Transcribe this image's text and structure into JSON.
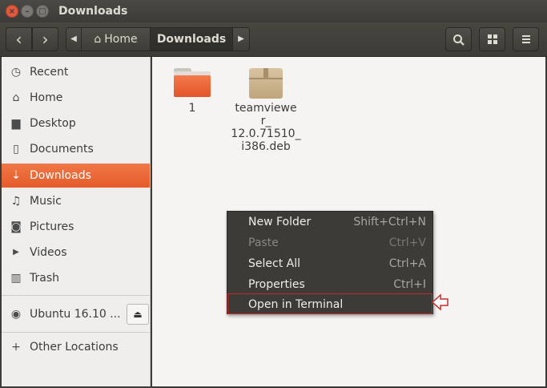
{
  "window": {
    "title": "Downloads",
    "controls": {
      "close": "×",
      "minimize": "–",
      "maximize": "□"
    }
  },
  "header": {
    "back_icon": "‹",
    "forward_icon": "›",
    "breadcrumb_left": "◀",
    "breadcrumb_right": "▶",
    "home_label": "Home",
    "current_label": "Downloads",
    "search_icon": "search-icon",
    "view_icon": "grid-icon",
    "menu_icon": "hamburger-icon"
  },
  "sidebar": {
    "items": [
      {
        "label": "Recent",
        "icon": "◷"
      },
      {
        "label": "Home",
        "icon": "⌂"
      },
      {
        "label": "Desktop",
        "icon": "▆"
      },
      {
        "label": "Documents",
        "icon": "▯"
      },
      {
        "label": "Downloads",
        "icon": "⇣",
        "active": true
      },
      {
        "label": "Music",
        "icon": "♫"
      },
      {
        "label": "Pictures",
        "icon": "◙"
      },
      {
        "label": "Videos",
        "icon": "▶"
      },
      {
        "label": "Trash",
        "icon": "▥"
      }
    ],
    "device": {
      "label": "Ubuntu 16.10 ...",
      "icon": "◉",
      "eject_icon": "⏏"
    },
    "other": {
      "label": "Other Locations",
      "icon": "+"
    }
  },
  "files": [
    {
      "name": "1",
      "type": "folder"
    },
    {
      "name_lines": [
        "teamviewe",
        "r_",
        "12.0.71510_",
        "i386.deb"
      ],
      "type": "package"
    }
  ],
  "context_menu": {
    "items": [
      {
        "label": "New Folder",
        "shortcut": "Shift+Ctrl+N",
        "enabled": true
      },
      {
        "label": "Paste",
        "shortcut": "Ctrl+V",
        "enabled": false
      },
      {
        "label": "Select All",
        "shortcut": "Ctrl+A",
        "enabled": true
      },
      {
        "label": "Properties",
        "shortcut": "Ctrl+I",
        "enabled": true
      },
      {
        "label": "Open in Terminal",
        "shortcut": "",
        "enabled": true,
        "highlighted": true
      }
    ]
  },
  "colors": {
    "accent": "#e95420",
    "highlight_border": "#c82a2a"
  }
}
